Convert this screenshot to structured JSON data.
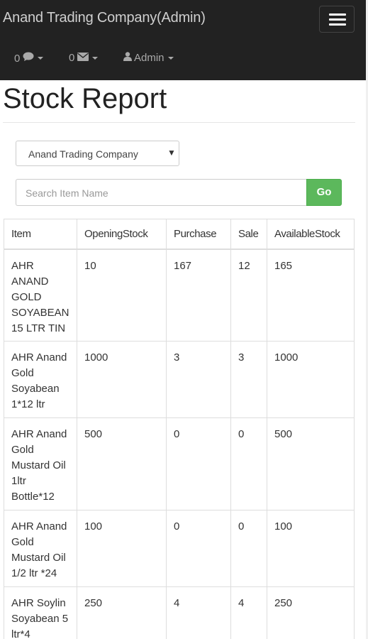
{
  "navbar": {
    "brand": "Anand Trading Company(Admin)",
    "comments": {
      "count": "0",
      "icon": "comment-icon"
    },
    "messages": {
      "count": "0",
      "icon": "envelope-icon"
    },
    "user": {
      "label": "Admin",
      "icon": "user-icon"
    }
  },
  "page": {
    "title": "Stock Report"
  },
  "filters": {
    "company_select": "Anand Trading Company",
    "search_placeholder": "Search Item Name",
    "go_label": "Go"
  },
  "table": {
    "headers": [
      "Item",
      "OpeningStock",
      "Purchase",
      "Sale",
      "AvailableStock"
    ],
    "rows": [
      [
        "AHR ANAND GOLD SOYABEAN 15 LTR TIN",
        "10",
        "167",
        "12",
        "165"
      ],
      [
        "AHR Anand Gold Soyabean 1*12 ltr",
        "1000",
        "3",
        "3",
        "1000"
      ],
      [
        "AHR Anand Gold Mustard Oil 1ltr Bottle*12",
        "500",
        "0",
        "0",
        "500"
      ],
      [
        "AHR Anand Gold Mustard Oil 1/2 ltr *24",
        "100",
        "0",
        "0",
        "100"
      ],
      [
        "AHR Soylin Soyabean 5 ltr*4",
        "250",
        "4",
        "4",
        "250"
      ]
    ]
  },
  "colors": {
    "navbar_bg": "#222222",
    "go_button": "#5cb85c"
  }
}
